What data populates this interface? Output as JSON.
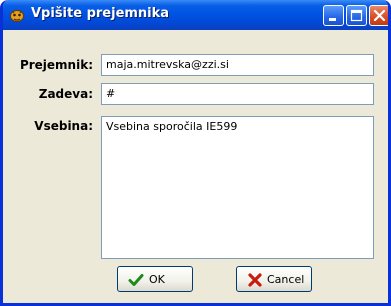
{
  "window": {
    "title": "Vpišite prejemnika",
    "icon": "app-logo-icon",
    "title_bar_color": "#0054e3",
    "frame_color": "#ece9d8",
    "controls": [
      "minimize-icon",
      "maximize-icon",
      "close-icon"
    ]
  },
  "form": {
    "recipient": {
      "label": "Prejemnik:",
      "value": "maja.mitrevska@zzi.si"
    },
    "subject": {
      "label": "Zadeva:",
      "value": "#"
    },
    "body": {
      "label": "Vsebina:",
      "value": "Vsebina sporočila IE599"
    }
  },
  "buttons": {
    "ok": {
      "label": "OK",
      "icon": "checkmark-icon"
    },
    "cancel": {
      "label": "Cancel",
      "icon": "x-mark-icon"
    }
  }
}
